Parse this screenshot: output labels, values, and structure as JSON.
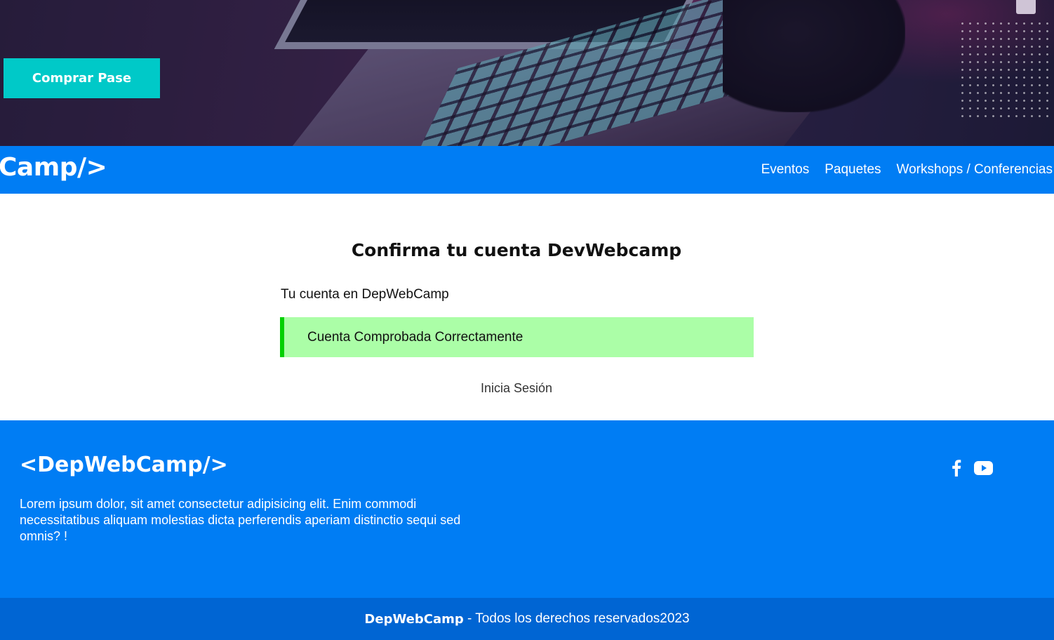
{
  "hero": {
    "buy_button_label": "Comprar Pase"
  },
  "navbar": {
    "brand": "Camp/>",
    "links": [
      {
        "label": "Eventos"
      },
      {
        "label": "Paquetes"
      },
      {
        "label": "Workshops / Conferencias"
      }
    ]
  },
  "main": {
    "title": "Confirma tu cuenta DevWebcamp",
    "intro": "Tu cuenta en DepWebCamp",
    "alert": {
      "message": "Cuenta Comprobada Correctamente",
      "background_color": "#abfea7",
      "border_color": "#00d000"
    },
    "login_link": "Inicia Sesión"
  },
  "footer": {
    "brand": "<DepWebCamp/>",
    "description": "Lorem ipsum dolor, sit amet consectetur adipisicing elit. Enim commodi necessitatibus aliquam molestias dicta perferendis aperiam distinctio sequi sed omnis? !",
    "social_icons": [
      "facebook-icon",
      "youtube-icon"
    ],
    "copyright_brand": "DepWebCamp",
    "copyright_text": " - Todos los derechos reservados2023"
  },
  "colors": {
    "primary_blue": "#007df4",
    "dark_blue": "#0065d3",
    "accent_teal": "#00c9c8"
  }
}
